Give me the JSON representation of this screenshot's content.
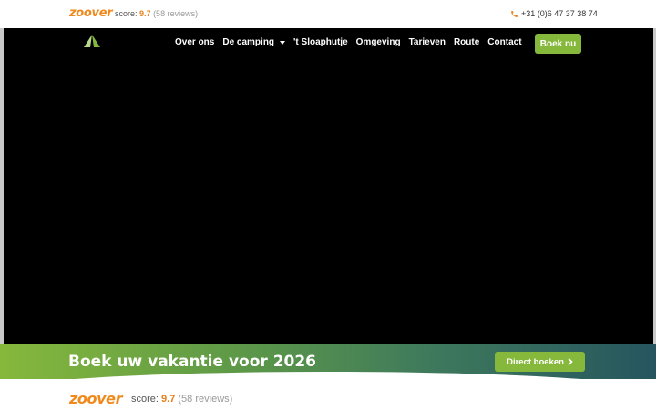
{
  "topbar": {
    "brand": "zoover",
    "score_label": "score:",
    "score_value": "9.7",
    "reviews": "(58 reviews)",
    "phone": "+31 (0)6 47 37 38 74"
  },
  "nav": {
    "items": [
      {
        "label": "Over ons"
      },
      {
        "label": "De camping"
      },
      {
        "label": "'t Sloaphutje"
      },
      {
        "label": "Omgeving"
      },
      {
        "label": "Tarieven"
      },
      {
        "label": "Route"
      },
      {
        "label": "Contact"
      }
    ],
    "book_label": "Boek nu"
  },
  "banner": {
    "title": "Boek uw vakantie voor 2026",
    "button_label": "Direct boeken"
  },
  "bottom": {
    "brand": "zoover",
    "score_label": "score:",
    "score_value": "9.7",
    "reviews": "(58 reviews)"
  },
  "colors": {
    "accent_green": "#86b83c",
    "zoover_orange": "#f08a1c",
    "banner_teal": "#26555f"
  },
  "icons": {
    "phone": "phone-icon",
    "caret": "chevron-down-icon",
    "arrow": "chevron-right-icon",
    "logo": "tent-icon"
  }
}
